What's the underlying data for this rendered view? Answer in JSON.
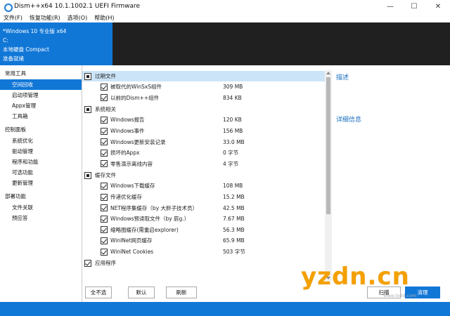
{
  "window": {
    "title": "Dism++x64 10.1.1002.1 UEFI Firmware",
    "minimize": "—",
    "maximize": "☐",
    "close": "✕"
  },
  "menu": [
    "文件(F)",
    "恢复功能(R)",
    "选项(O)",
    "帮助(H)"
  ],
  "info": {
    "os": "*Windows 10 专业版 x64",
    "drive": "C:",
    "disk": "本地硬盘 Compact",
    "status": "准备就绪"
  },
  "sidebar": {
    "groups": [
      {
        "label": "常用工具",
        "items": [
          "空间回收",
          "启动项管理",
          "Appx管理",
          "工具箱"
        ]
      },
      {
        "label": "控制面板",
        "items": [
          "系统优化",
          "驱动管理",
          "程序和功能",
          "可选功能",
          "更新管理"
        ]
      },
      {
        "label": "部署功能",
        "items": [
          "文件关联",
          "预应答"
        ]
      }
    ],
    "active": "空间回收"
  },
  "sections": [
    {
      "title": "过期文件",
      "state": "partial",
      "items": [
        {
          "label": "被取代的WinSxS组件",
          "size": "309 MB",
          "checked": true
        },
        {
          "label": "以前的Dism++组件",
          "size": "834 KB",
          "checked": true
        }
      ]
    },
    {
      "title": "系统相关",
      "state": "partial",
      "items": [
        {
          "label": "Windows报告",
          "size": "120 KB",
          "checked": true
        },
        {
          "label": "Windows事件",
          "size": "156 MB",
          "checked": true
        },
        {
          "label": "Windows更新安装记录",
          "size": "33.0 MB",
          "checked": true
        },
        {
          "label": "损坏的Appx",
          "size": "0 字节",
          "checked": true
        },
        {
          "label": "零售演示离线内容",
          "size": "4 字节",
          "checked": true
        }
      ]
    },
    {
      "title": "缓存文件",
      "state": "partial",
      "items": [
        {
          "label": "Windows下载缓存",
          "size": "108 MB",
          "checked": true
        },
        {
          "label": "传递优化缓存",
          "size": "15.2 MB",
          "checked": true
        },
        {
          "label": "NET程序集缓存（by 大胖子技术员）",
          "size": "42.5 MB",
          "checked": true
        },
        {
          "label": "Windows预读取文件（by 辰g.）",
          "size": "7.67 MB",
          "checked": true
        },
        {
          "label": "缩略图缓存(需重启explorer)",
          "size": "56.3 MB",
          "checked": true
        },
        {
          "label": "WinINet网页缓存",
          "size": "65.9 MB",
          "checked": true
        },
        {
          "label": "WinINet Cookies",
          "size": "503 字节",
          "checked": true
        }
      ]
    },
    {
      "title": "应用程序",
      "state": "checked",
      "items": []
    }
  ],
  "buttons": {
    "select_none": "全不选",
    "default": "默认",
    "refresh": "刷新",
    "scan": "扫描",
    "clean": "清理"
  },
  "right_panel": {
    "description": "描述",
    "details": "详细信息"
  },
  "watermark": {
    "main": "yzdn.cn",
    "sub": "www.lo4d.com"
  },
  "colors": {
    "accent": "#1177d7",
    "dark_panel": "#202020",
    "selected_row": "#cce4f7",
    "watermark": "#f4a000"
  }
}
